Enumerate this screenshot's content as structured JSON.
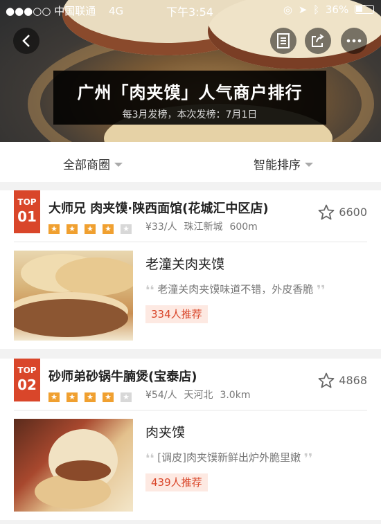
{
  "status_bar": {
    "carrier": "●●●○○ 中国联通",
    "network": "4G",
    "time": "下午3:54",
    "battery": "36%"
  },
  "header": {
    "title": "广州「肉夹馍」人气商户排行",
    "subtitle": "每3月发榜，本次发榜：7月1日"
  },
  "filters": {
    "area": "全部商圈",
    "sort": "智能排序"
  },
  "shops": [
    {
      "rank_label": "TOP",
      "rank_num": "01",
      "name": "大师兄 肉夹馍·陕西面馆(花城汇中区店)",
      "rating": 4,
      "price": "¥33/人",
      "district": "珠江新城",
      "distance": "600m",
      "favorites": "6600",
      "dish": "老潼关肉夹馍",
      "review": "老潼关肉夹馍味道不错，外皮香脆",
      "recommend": "334人推荐"
    },
    {
      "rank_label": "TOP",
      "rank_num": "02",
      "name": "砂师弟砂锅牛腩煲(宝泰店)",
      "rating": 4,
      "price": "¥54/人",
      "district": "天河北",
      "distance": "3.0km",
      "favorites": "4868",
      "dish": "肉夹馍",
      "review": "[调皮]肉夹馍新鲜出炉外脆里嫩",
      "recommend": "439人推荐"
    }
  ],
  "colors": {
    "accent": "#d9462a",
    "star": "#f0a030"
  }
}
